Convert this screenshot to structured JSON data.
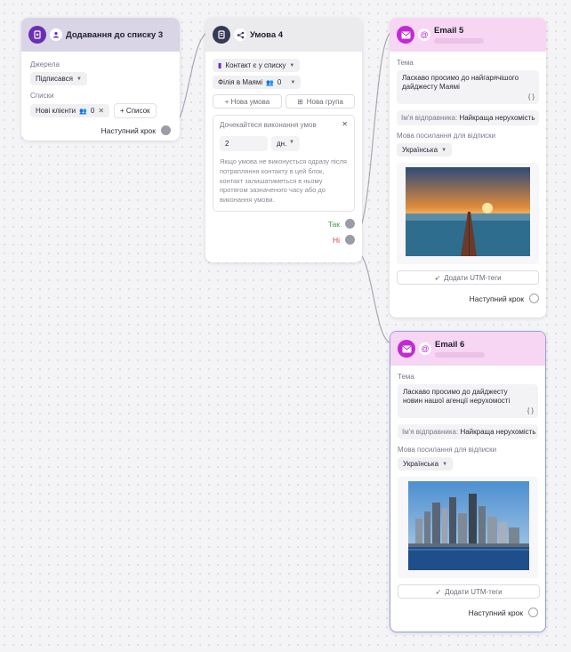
{
  "node_list": {
    "title": "Додавання до списку 3",
    "sources_label": "Джерела",
    "source_value": "Підписався",
    "lists_label": "Списки",
    "list_chip": "Нові клієнти",
    "list_count": "0",
    "add_list": "+ Список",
    "next_step": "Наступний крок"
  },
  "node_condition": {
    "title": "Умова 4",
    "filter_contact": "Контакт є у списку",
    "filter_list": "Філія в Маямі",
    "filter_count": "0",
    "new_condition": "+ Нова умова",
    "new_group": "Нова група",
    "wait_label": "Дочекайтеся виконання умов",
    "wait_value": "2",
    "wait_unit": "дн.",
    "wait_hint": "Якщо умова не виконується одразу після потрапляння контакту в цей блок, контакт залишатиметься в ньому протягом зазначеного часу або до виконання умови.",
    "yes_label": "Так",
    "no_label": "Ні"
  },
  "node_email5": {
    "title": "Email 5",
    "subject_label": "Тема",
    "subject_value": "Ласкаво просимо до найгарячішого дайджесту Маямі",
    "braces": "{ }",
    "sender_label": "Ім'я відправника:",
    "sender_value": "Найкраща нерухомість",
    "lang_label": "Мова посилання для відписки",
    "lang_value": "Українська",
    "utm_button": "Додати UTM-теги",
    "next_step": "Наступний крок"
  },
  "node_email6": {
    "title": "Email 6",
    "subject_label": "Тема",
    "subject_value": "Ласкаво просимо до дайджесту новин нашої агенції нерухомості",
    "braces": "{ }",
    "sender_label": "Ім'я відправника:",
    "sender_value": "Найкраща нерухомість",
    "lang_label": "Мова посилання для відписки",
    "lang_value": "Українська",
    "utm_button": "Додати UTM-теги",
    "next_step": "Наступний крок"
  },
  "colors": {
    "accent_purple": "#6b2fb3",
    "email_magenta": "#c02ad2",
    "yes_green": "#3a9a4a",
    "no_red": "#d9453a"
  }
}
